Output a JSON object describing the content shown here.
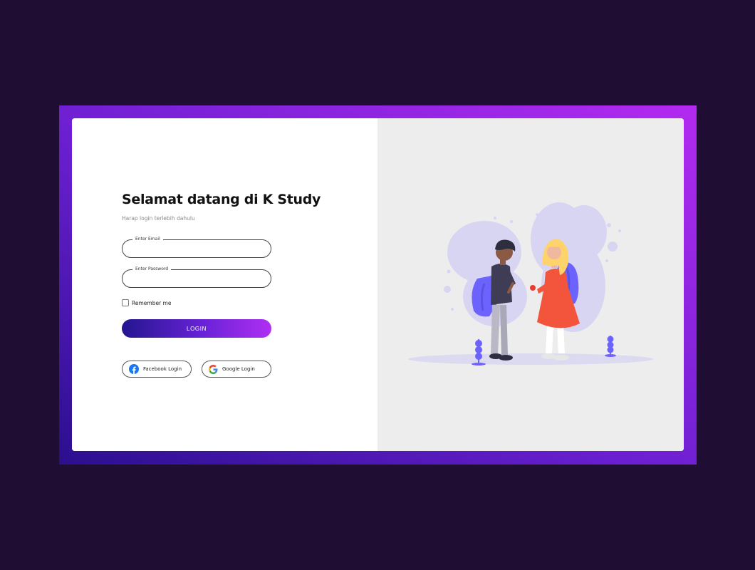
{
  "login": {
    "title": "Selamat datang di K Study",
    "subtitle": "Harap login terlebih dahulu",
    "email_label": "Enter Email",
    "email_value": "",
    "password_label": "Enter Password",
    "password_value": "",
    "remember_label": "Remember me",
    "remember_checked": false,
    "login_button": "LOGIN",
    "facebook_button": "Facebook Login",
    "google_button": "Google Login"
  },
  "colors": {
    "page_background": "#1f0d33",
    "gradient_start": "#23168f",
    "gradient_end": "#b02ff2",
    "illustration_panel": "#ededed",
    "illustration_accent": "#6c63ff"
  },
  "icons": {
    "facebook": "facebook-icon",
    "google": "google-icon",
    "checkbox": "checkbox-icon"
  }
}
